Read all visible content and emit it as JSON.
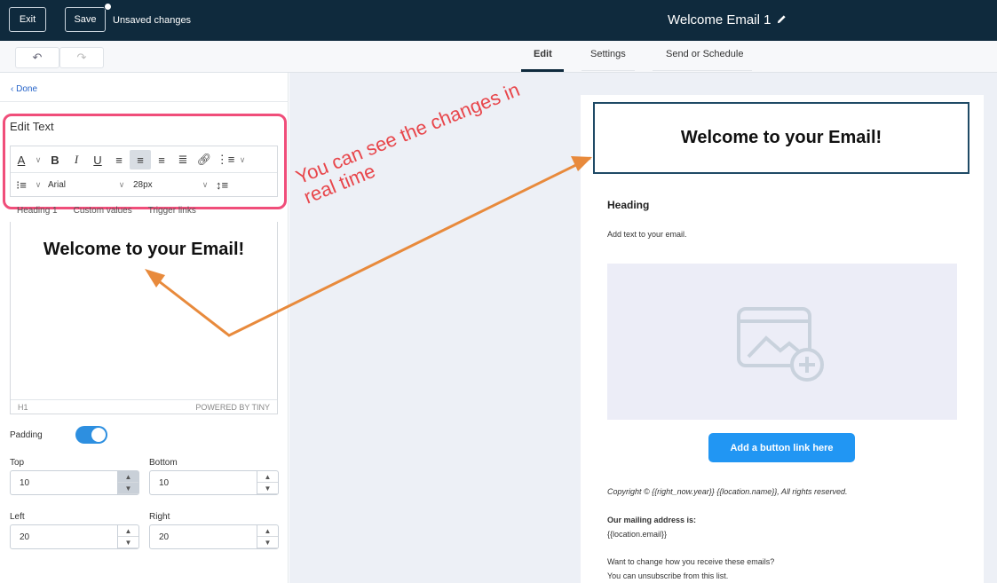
{
  "topbar": {
    "exit_label": "Exit",
    "save_label": "Save",
    "unsaved": "Unsaved changes",
    "title": "Welcome Email 1",
    "edit_icon": "pencil-icon"
  },
  "tabs": [
    {
      "label": "Edit",
      "active": true
    },
    {
      "label": "Settings"
    },
    {
      "label": "Send or Schedule"
    }
  ],
  "left": {
    "done": "Done",
    "edit_text": "Edit Text",
    "font": "Arial",
    "size": "28px",
    "dropdowns": [
      "Heading 1",
      "Custom values",
      "Trigger links"
    ],
    "editor_heading": "Welcome to your Email!",
    "status_left": "H1",
    "status_right": "POWERED BY TINY",
    "padding_label": "Padding",
    "padding_on": true,
    "top_label": "Top",
    "top_value": "10",
    "bottom_label": "Bottom",
    "bottom_value": "10",
    "left_label": "Left",
    "left_value": "20",
    "right_label": "Right",
    "right_value": "20"
  },
  "annotation": "You can see the changes in real time",
  "email": {
    "header": "Welcome to your Email!",
    "heading": "Heading",
    "text": "Add text to your email.",
    "button": "Add a button link here",
    "copyright": "Copyright © {{right_now.year}}  {{location.name}}, All rights reserved.",
    "mailing_label": "Our mailing address is:",
    "mailing_value": "{{location.email}}",
    "change": "Want to change how you receive these emails?",
    "unsub": "You can unsubscribe from this list."
  },
  "colors": {
    "topbar": "#0f2a3d",
    "accent": "#2196f3",
    "highlight": "#f04e7a",
    "annotation": "#e8464b",
    "arrow": "#e88a3c"
  }
}
